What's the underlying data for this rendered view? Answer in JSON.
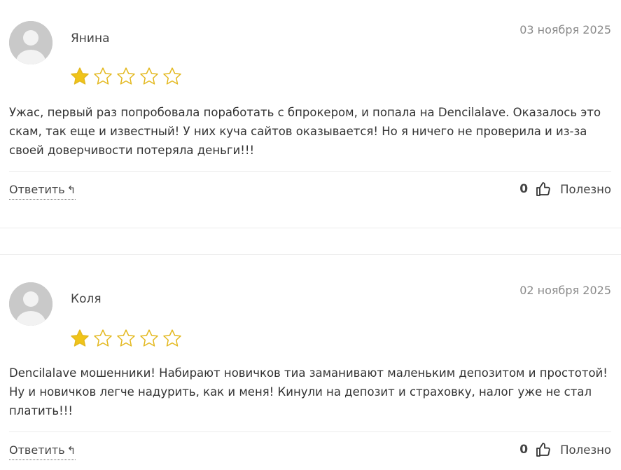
{
  "reviews": [
    {
      "author": "Янина",
      "date": "03 ноября 2025",
      "rating": 1,
      "max_rating": 5,
      "text": "Ужас, первый раз попробовала поработать с бпрокером, и попала на Dencilalave. Оказалось это скам, так еще и известный! У них куча сайтов оказывается! Но я ничего не проверила и из-за своей доверчивости потеряла деньги!!!",
      "reply_label": "Ответить",
      "likes": "0",
      "helpful_label": "Полезно"
    },
    {
      "author": "Коля",
      "date": "02 ноября 2025",
      "rating": 1,
      "max_rating": 5,
      "text": "Dencilalave мошенники! Набирают новичков тиа заманивают маленьким депозитом и простотой! Ну и новичков легче надурить, как и меня! Кинули на депозит и страховку, налог уже не стал платить!!!",
      "reply_label": "Ответить",
      "likes": "0",
      "helpful_label": "Полезно"
    }
  ],
  "colors": {
    "star_filled": "#f0c419",
    "star_outline": "#e3b81e",
    "avatar_bg": "#c9c9c9",
    "text": "#333333",
    "muted": "#8a8a8a"
  },
  "icons": {
    "avatar": "user-avatar-icon",
    "star": "star-icon",
    "reply": "reply-arrow-icon",
    "like": "thumbs-up-icon"
  }
}
